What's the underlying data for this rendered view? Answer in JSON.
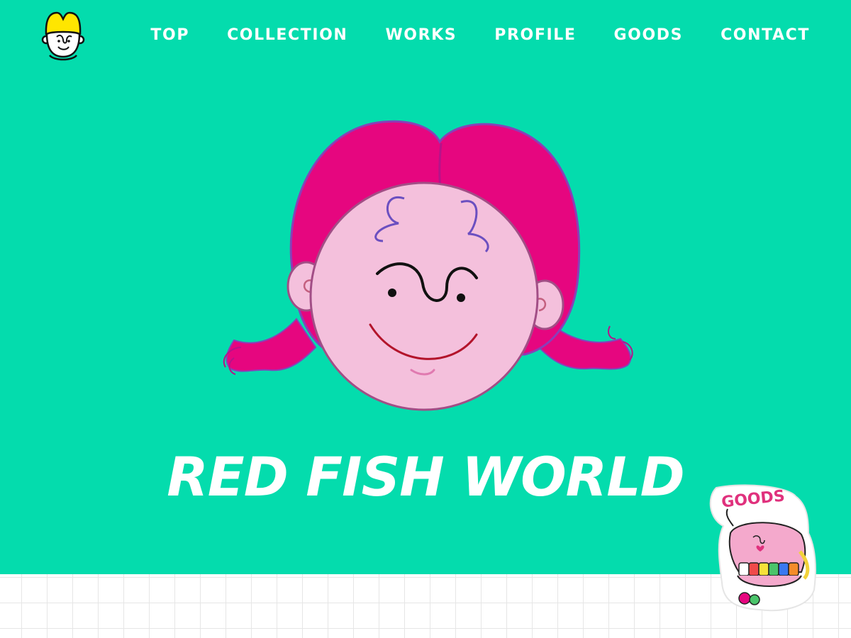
{
  "nav": {
    "items": [
      {
        "label": "TOP"
      },
      {
        "label": "COLLECTION"
      },
      {
        "label": "WORKS"
      },
      {
        "label": "PROFILE"
      },
      {
        "label": "GOODS"
      },
      {
        "label": "CONTACT"
      }
    ]
  },
  "hero": {
    "title": "RED FISH WORLD",
    "illustration": "pink-haired-girl-face"
  },
  "goods_sticker": {
    "label": "GOODS",
    "illustration": "pink-dentures-character"
  },
  "colors": {
    "background": "#04dcad",
    "hair": "#e6067f",
    "skin": "#f4c0dc",
    "logo_hair": "#ffe600",
    "sticker_text": "#e0317d",
    "nav_text": "#ffffff"
  },
  "icons": {
    "logo": "face-logo-icon"
  }
}
